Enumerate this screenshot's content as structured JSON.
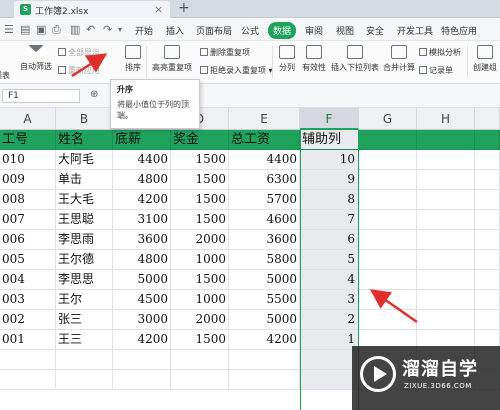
{
  "window": {
    "tab_title": "工作簿2.xlsx",
    "close_glyph": "×",
    "new_tab_glyph": "+"
  },
  "menu": {
    "items": [
      "开始",
      "插入",
      "页面布局",
      "公式",
      "数据",
      "审阅",
      "视图",
      "安全",
      "开发工具",
      "特色应用"
    ],
    "active": "数据"
  },
  "ribbon": {
    "pivot_partial": "透表",
    "auto_filter": "自动筛选",
    "show_all": "全部显示",
    "reapply": "重新应用",
    "sort_label": "排序",
    "highlight_dup": "高亮重复项",
    "delete_dup": "删除重复项",
    "reject_dup": "拒绝录入重复项",
    "split": "分列",
    "validity": "有效性",
    "insert_dropdown": "插入下拉列表",
    "merge_calc": "合并计算",
    "simulate": "模拟分析",
    "record": "记录单",
    "create_group": "创建组"
  },
  "formula_bar": {
    "cell_ref": "F1",
    "fx_glyph": "fx"
  },
  "tooltip": {
    "title": "升序",
    "desc_line1": "将最小值位于列的顶",
    "desc_line2": "端。"
  },
  "sheet": {
    "columns": [
      "A",
      "B",
      "C",
      "D",
      "E",
      "F",
      "G",
      "H"
    ],
    "selected_column": "F",
    "header": [
      "工号",
      "姓名",
      "底薪",
      "奖金",
      "总工资",
      "辅助列"
    ],
    "rows": [
      [
        "010",
        "大阿毛",
        "4400",
        "1500",
        "4400",
        "10"
      ],
      [
        "009",
        "单击",
        "4800",
        "1500",
        "6300",
        "9"
      ],
      [
        "008",
        "王大毛",
        "4200",
        "1500",
        "5700",
        "8"
      ],
      [
        "007",
        "王思聪",
        "3100",
        "1500",
        "4600",
        "7"
      ],
      [
        "006",
        "李思雨",
        "3600",
        "2000",
        "3600",
        "6"
      ],
      [
        "005",
        "王尔德",
        "4800",
        "1000",
        "5800",
        "5"
      ],
      [
        "004",
        "李思思",
        "5000",
        "1500",
        "5000",
        "4"
      ],
      [
        "003",
        "王尔",
        "4500",
        "1000",
        "5500",
        "3"
      ],
      [
        "002",
        "张三",
        "3000",
        "2000",
        "5000",
        "2"
      ],
      [
        "001",
        "王三",
        "4200",
        "1500",
        "4200",
        "1"
      ]
    ]
  },
  "watermark": {
    "brand": "溜溜自学",
    "domain": "ZIXUE.3D66.COM"
  },
  "colors": {
    "accent_green": "#1fa35c",
    "arrow_red": "#e0302c"
  }
}
